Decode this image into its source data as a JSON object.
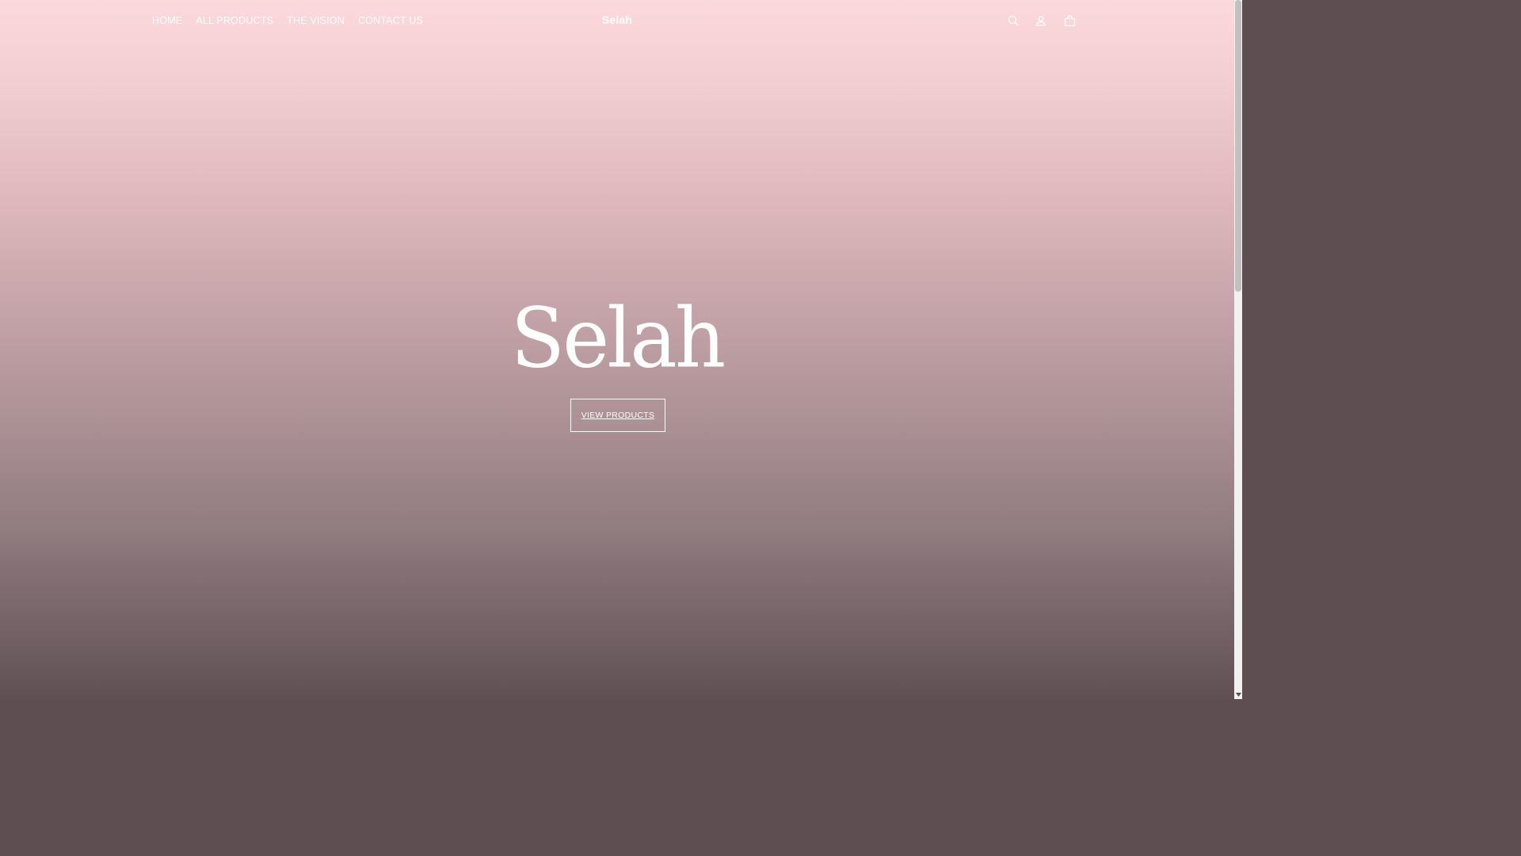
{
  "header": {
    "nav": [
      {
        "label": "HOME"
      },
      {
        "label": "ALL PRODUCTS"
      },
      {
        "label": "THE VISION"
      },
      {
        "label": "CONTACT US"
      }
    ],
    "logo": "Selah",
    "icons": [
      "search-icon",
      "account-icon",
      "cart-icon"
    ]
  },
  "hero": {
    "title": "Selah",
    "cta_label": "VIEW PRODUCTS"
  },
  "colors": {
    "gradient_top": "#fcd9dd",
    "gradient_bottom": "#5f5054",
    "text": "#ffffff"
  }
}
